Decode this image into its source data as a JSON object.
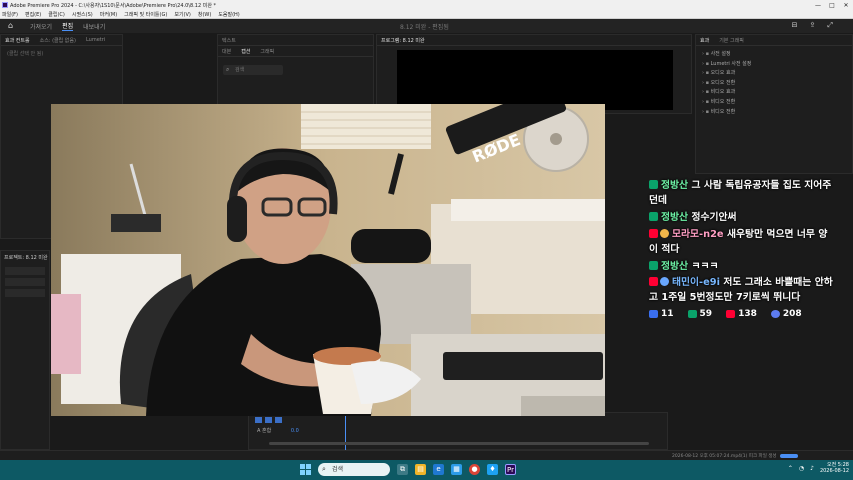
{
  "window": {
    "title": "Adobe Premiere Pro 2024 - C:\\사용자\\1S10\\문서\\Adobe\\Premiere Pro\\24.0\\8.12 미완 *",
    "controls": [
      "—",
      "□",
      "✕"
    ]
  },
  "menu": [
    "파일(F)",
    "편집(E)",
    "클립(C)",
    "시퀀스(S)",
    "마커(M)",
    "그래픽 및 타이틀(G)",
    "보기(V)",
    "창(W)",
    "도움말(H)"
  ],
  "workspace": {
    "tabs": [
      "가져오기",
      "편집",
      "내보내기"
    ],
    "active": "편집",
    "center_title": "8.12 미완 - 편집됨"
  },
  "panels": {
    "effect_controls": {
      "tabs": [
        "효과 컨트롤",
        "소스: (클립 없음)",
        "Lumetri"
      ],
      "message": "(클립 선택 안 됨)"
    },
    "text": {
      "tabs": [
        "대본",
        "캡션",
        "그래픽"
      ],
      "title": "텍스트",
      "search_placeholder": "검색"
    },
    "program": {
      "title": "프로그램: 8.12 미완"
    },
    "effects": {
      "tabs": [
        "효과",
        "기본 그래픽"
      ],
      "items": [
        "사전 설정",
        "Lumetri 사전 설정",
        "오디오 효과",
        "오디오 전환",
        "비디오 효과",
        "비디오 전환",
        "비디오 전환"
      ]
    },
    "project": {
      "title": "프로젝트: 8.12 미완"
    },
    "timeline": {
      "track_label": "A 혼합",
      "value": "0.0"
    }
  },
  "status": {
    "text": "2026-08-12 오후 05:07:24.mp4(1) 피크 파일 생성"
  },
  "taskbar": {
    "search_placeholder": "검색",
    "clock_time": "오전 5:28",
    "clock_date": "2026-08-12"
  },
  "chat": {
    "colors": {
      "chzzk": "#0aa36a",
      "youtube": "#ff0033",
      "afreeca": "#3a6ff0",
      "name_green": "#6ff5a8"
    },
    "messages": [
      {
        "platform": "chzzk",
        "name": "정방산",
        "text": "그 사람 독립유공자들 집도 지어주"
      },
      {
        "platform": "chzzk",
        "name": "",
        "text": "던데"
      },
      {
        "platform": "chzzk",
        "name": "정방산",
        "text": "정수기안써"
      },
      {
        "platform": "youtube",
        "name": "모라모-n2e",
        "text": "새우탕만 먹으면 너무 양"
      },
      {
        "platform": "youtube",
        "name": "",
        "text": "이 적다"
      },
      {
        "platform": "chzzk",
        "name": "정방산",
        "text": "ㅋㅋㅋ"
      },
      {
        "platform": "youtube",
        "name": "태민이-e9i",
        "text": "저도 그래소 바쁠때는 안하"
      },
      {
        "platform": "youtube",
        "name": "",
        "text": "고 1주일 5번정도만 7키로씩 뛰니다"
      }
    ],
    "viewers": [
      {
        "platform": "afreeca-soop",
        "icon": "link-icon",
        "count": "11"
      },
      {
        "platform": "chzzk",
        "icon": "chzzk-icon",
        "count": "59"
      },
      {
        "platform": "youtube",
        "icon": "youtube-icon",
        "count": "138"
      },
      {
        "platform": "other",
        "icon": "bubble-icon",
        "count": "208"
      }
    ]
  },
  "webcam": {
    "microphone_brand": "RØDE"
  }
}
